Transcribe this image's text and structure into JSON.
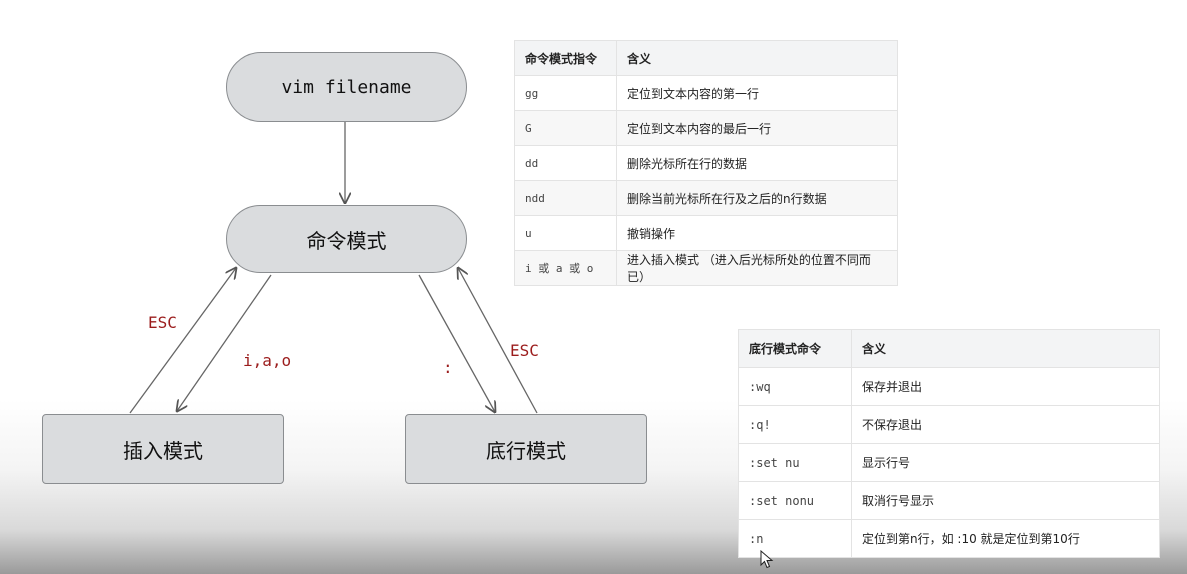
{
  "diagram": {
    "nodes": {
      "vim": "vim filename",
      "command": "命令模式",
      "insert": "插入模式",
      "bottom": "底行模式"
    },
    "edge_labels": {
      "insert_to_command": "ESC",
      "command_to_insert": "i,a,o",
      "command_to_bottom": ":",
      "bottom_to_command": "ESC"
    },
    "label_color": "#9b1c1c"
  },
  "command_table": {
    "headers": [
      "命令模式指令",
      "含义"
    ],
    "rows": [
      [
        "gg",
        "定位到文本内容的第一行"
      ],
      [
        "G",
        "定位到文本内容的最后一行"
      ],
      [
        "dd",
        "删除光标所在行的数据"
      ],
      [
        "ndd",
        "删除当前光标所在行及之后的n行数据"
      ],
      [
        "u",
        "撤销操作"
      ],
      [
        "i 或 a 或 o",
        "进入插入模式 （进入后光标所处的位置不同而已）"
      ]
    ]
  },
  "bottom_table": {
    "headers": [
      "底行模式命令",
      "含义"
    ],
    "rows": [
      [
        ":wq",
        "保存并退出"
      ],
      [
        ":q!",
        "不保存退出"
      ],
      [
        ":set nu",
        "显示行号"
      ],
      [
        ":set nonu",
        "取消行号显示"
      ],
      [
        ":n",
        "定位到第n行，如 :10 就是定位到第10行"
      ]
    ]
  },
  "icons": {
    "cursor": "mouse-pointer-icon"
  }
}
